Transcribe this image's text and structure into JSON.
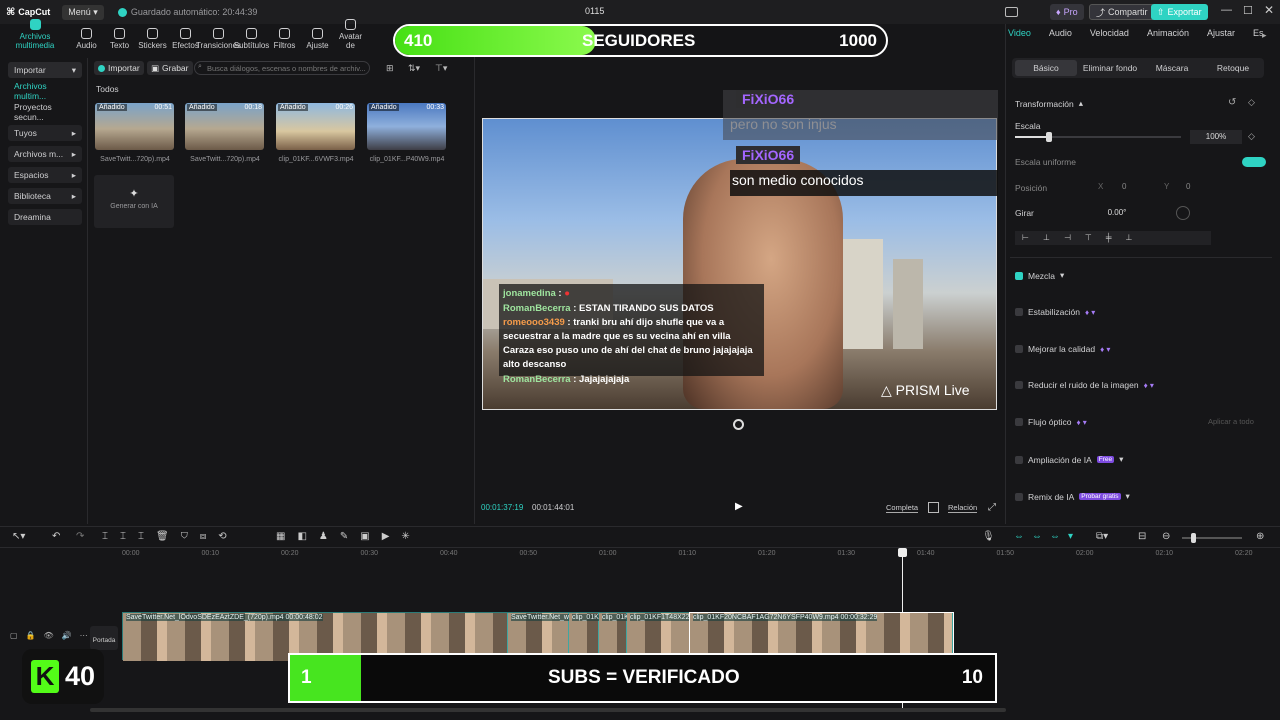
{
  "topbar": {
    "app_name": "CapCut",
    "menu_label": "Menú",
    "autosave": "Guardado automático: 20:44:39",
    "project_title": "0115",
    "pro_label": "Pro",
    "share_label": "Compartir",
    "export_label": "Exportar"
  },
  "tools": [
    "Archivos multimedia",
    "Audio",
    "Texto",
    "Stickers",
    "Efectos",
    "Transiciones",
    "Subtítulos",
    "Filtros",
    "Ajuste",
    "Avatar de"
  ],
  "leftnav": {
    "import": "Importar",
    "items": [
      "Archivos multim...",
      "Proyectos secun...",
      "Tuyos",
      "Archivos m...",
      "Espacios",
      "Biblioteca",
      "Dreamina"
    ]
  },
  "media": {
    "import_btn": "Importar",
    "record_btn": "Grabar",
    "search_placeholder": "Busca diálogos, escenas o nombres de archiv...",
    "filter_label": "Todos",
    "added_badge": "Añadido",
    "thumbs": [
      {
        "name": "SaveTwitt...720p).mp4",
        "dur": "00:51"
      },
      {
        "name": "SaveTwitt...720p).mp4",
        "dur": "00:18"
      },
      {
        "name": "clip_01KF...6VWF3.mp4",
        "dur": "00:26"
      },
      {
        "name": "clip_01KF...P40W9.mp4",
        "dur": "00:33"
      }
    ],
    "generate_label": "Generar con IA"
  },
  "preview": {
    "fixio_name": "FiXiO66",
    "fixio_msg1": "pero no son injus",
    "fixio_msg2": "son medio conocidos",
    "chat": [
      {
        "user": "jonamedina",
        "msg": ""
      },
      {
        "user": "RomanBecerra",
        "msg": "ESTAN TIRANDO SUS DATOS"
      },
      {
        "user": "romeooo3439",
        "msg": "tranki bru ahí dijo shufle que va a secuestrar a la madre que es su vecina ahí en villa Caraza eso puso uno de ahí del chat de bruno jajajajaja alto descanso"
      },
      {
        "user": "RomanBecerra",
        "msg": "Jajajajajaja"
      }
    ],
    "watermark": "PRISM Live",
    "time_current": "00:01:37:19",
    "time_total": "00:01:44:01",
    "view_full": "Completa",
    "view_ratio": "Relación"
  },
  "right": {
    "tabs": [
      "Video",
      "Audio",
      "Velocidad",
      "Animación",
      "Ajustar",
      "Es"
    ],
    "subtabs": [
      "Básico",
      "Eliminar fondo",
      "Máscara",
      "Retoque"
    ],
    "transform": "Transformación",
    "scale_label": "Escala",
    "scale_value": "100%",
    "uniform_label": "Escala uniforme",
    "position_label": "Posición",
    "pos_x_label": "X",
    "pos_x": "0",
    "pos_y_label": "Y",
    "pos_y": "0",
    "rotate_label": "Girar",
    "rotate_value": "0.00°",
    "blend": "Mezcla",
    "stabilize": "Estabilización",
    "improve": "Mejorar la calidad",
    "noise": "Reducir el ruido de la imagen",
    "optical": "Flujo óptico",
    "apply_all": "Aplicar a todo",
    "ai_expand": "Ampliación de IA",
    "free_badge": "Free",
    "ai_remix": "Remix de IA",
    "try_badge": "Probar gratis",
    "accent": "#2fd3c3"
  },
  "timeline": {
    "ruler": [
      "00:00",
      "00:10",
      "00:20",
      "00:30",
      "00:40",
      "00:50",
      "01:00",
      "01:10",
      "01:20",
      "01:30",
      "01:40",
      "01:50",
      "02:00",
      "02:10",
      "02:20"
    ],
    "cover_label": "Portada",
    "clips": [
      "SaveTwitter.Net_lOdvoSDEzEAztZDE_(720p).mp4  00:00:48:02",
      "SaveTwitter.Net_w",
      "clip_01Kf",
      "clip_01Kf",
      "clip_01KF1T48X22B",
      "clip_01KF20NCBAF1AG72N6YSFP40W9.mp4  00:00:32:29"
    ]
  },
  "overlays": {
    "followers_current": "410",
    "followers_label": "SEGUIDORES",
    "followers_goal": "1000",
    "followers_progress": 0.41,
    "subs_current": "1",
    "subs_label": "SUBS = VERIFICADO",
    "subs_goal": "10",
    "subs_progress": 0.1,
    "kick_count": "40",
    "kick_letter": "K"
  }
}
